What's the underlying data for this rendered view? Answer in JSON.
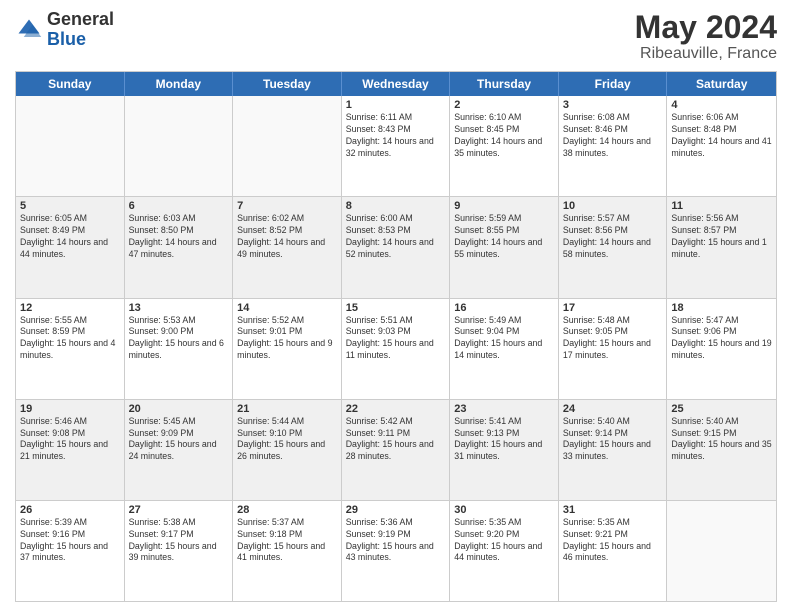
{
  "header": {
    "logo_general": "General",
    "logo_blue": "Blue",
    "month_year": "May 2024",
    "location": "Ribeauville, France"
  },
  "days_of_week": [
    "Sunday",
    "Monday",
    "Tuesday",
    "Wednesday",
    "Thursday",
    "Friday",
    "Saturday"
  ],
  "rows": [
    [
      {
        "day": "",
        "empty": true
      },
      {
        "day": "",
        "empty": true
      },
      {
        "day": "",
        "empty": true
      },
      {
        "day": "1",
        "sunrise": "Sunrise: 6:11 AM",
        "sunset": "Sunset: 8:43 PM",
        "daylight": "Daylight: 14 hours and 32 minutes."
      },
      {
        "day": "2",
        "sunrise": "Sunrise: 6:10 AM",
        "sunset": "Sunset: 8:45 PM",
        "daylight": "Daylight: 14 hours and 35 minutes."
      },
      {
        "day": "3",
        "sunrise": "Sunrise: 6:08 AM",
        "sunset": "Sunset: 8:46 PM",
        "daylight": "Daylight: 14 hours and 38 minutes."
      },
      {
        "day": "4",
        "sunrise": "Sunrise: 6:06 AM",
        "sunset": "Sunset: 8:48 PM",
        "daylight": "Daylight: 14 hours and 41 minutes."
      }
    ],
    [
      {
        "day": "5",
        "sunrise": "Sunrise: 6:05 AM",
        "sunset": "Sunset: 8:49 PM",
        "daylight": "Daylight: 14 hours and 44 minutes."
      },
      {
        "day": "6",
        "sunrise": "Sunrise: 6:03 AM",
        "sunset": "Sunset: 8:50 PM",
        "daylight": "Daylight: 14 hours and 47 minutes."
      },
      {
        "day": "7",
        "sunrise": "Sunrise: 6:02 AM",
        "sunset": "Sunset: 8:52 PM",
        "daylight": "Daylight: 14 hours and 49 minutes."
      },
      {
        "day": "8",
        "sunrise": "Sunrise: 6:00 AM",
        "sunset": "Sunset: 8:53 PM",
        "daylight": "Daylight: 14 hours and 52 minutes."
      },
      {
        "day": "9",
        "sunrise": "Sunrise: 5:59 AM",
        "sunset": "Sunset: 8:55 PM",
        "daylight": "Daylight: 14 hours and 55 minutes."
      },
      {
        "day": "10",
        "sunrise": "Sunrise: 5:57 AM",
        "sunset": "Sunset: 8:56 PM",
        "daylight": "Daylight: 14 hours and 58 minutes."
      },
      {
        "day": "11",
        "sunrise": "Sunrise: 5:56 AM",
        "sunset": "Sunset: 8:57 PM",
        "daylight": "Daylight: 15 hours and 1 minute."
      }
    ],
    [
      {
        "day": "12",
        "sunrise": "Sunrise: 5:55 AM",
        "sunset": "Sunset: 8:59 PM",
        "daylight": "Daylight: 15 hours and 4 minutes."
      },
      {
        "day": "13",
        "sunrise": "Sunrise: 5:53 AM",
        "sunset": "Sunset: 9:00 PM",
        "daylight": "Daylight: 15 hours and 6 minutes."
      },
      {
        "day": "14",
        "sunrise": "Sunrise: 5:52 AM",
        "sunset": "Sunset: 9:01 PM",
        "daylight": "Daylight: 15 hours and 9 minutes."
      },
      {
        "day": "15",
        "sunrise": "Sunrise: 5:51 AM",
        "sunset": "Sunset: 9:03 PM",
        "daylight": "Daylight: 15 hours and 11 minutes."
      },
      {
        "day": "16",
        "sunrise": "Sunrise: 5:49 AM",
        "sunset": "Sunset: 9:04 PM",
        "daylight": "Daylight: 15 hours and 14 minutes."
      },
      {
        "day": "17",
        "sunrise": "Sunrise: 5:48 AM",
        "sunset": "Sunset: 9:05 PM",
        "daylight": "Daylight: 15 hours and 17 minutes."
      },
      {
        "day": "18",
        "sunrise": "Sunrise: 5:47 AM",
        "sunset": "Sunset: 9:06 PM",
        "daylight": "Daylight: 15 hours and 19 minutes."
      }
    ],
    [
      {
        "day": "19",
        "sunrise": "Sunrise: 5:46 AM",
        "sunset": "Sunset: 9:08 PM",
        "daylight": "Daylight: 15 hours and 21 minutes."
      },
      {
        "day": "20",
        "sunrise": "Sunrise: 5:45 AM",
        "sunset": "Sunset: 9:09 PM",
        "daylight": "Daylight: 15 hours and 24 minutes."
      },
      {
        "day": "21",
        "sunrise": "Sunrise: 5:44 AM",
        "sunset": "Sunset: 9:10 PM",
        "daylight": "Daylight: 15 hours and 26 minutes."
      },
      {
        "day": "22",
        "sunrise": "Sunrise: 5:42 AM",
        "sunset": "Sunset: 9:11 PM",
        "daylight": "Daylight: 15 hours and 28 minutes."
      },
      {
        "day": "23",
        "sunrise": "Sunrise: 5:41 AM",
        "sunset": "Sunset: 9:13 PM",
        "daylight": "Daylight: 15 hours and 31 minutes."
      },
      {
        "day": "24",
        "sunrise": "Sunrise: 5:40 AM",
        "sunset": "Sunset: 9:14 PM",
        "daylight": "Daylight: 15 hours and 33 minutes."
      },
      {
        "day": "25",
        "sunrise": "Sunrise: 5:40 AM",
        "sunset": "Sunset: 9:15 PM",
        "daylight": "Daylight: 15 hours and 35 minutes."
      }
    ],
    [
      {
        "day": "26",
        "sunrise": "Sunrise: 5:39 AM",
        "sunset": "Sunset: 9:16 PM",
        "daylight": "Daylight: 15 hours and 37 minutes."
      },
      {
        "day": "27",
        "sunrise": "Sunrise: 5:38 AM",
        "sunset": "Sunset: 9:17 PM",
        "daylight": "Daylight: 15 hours and 39 minutes."
      },
      {
        "day": "28",
        "sunrise": "Sunrise: 5:37 AM",
        "sunset": "Sunset: 9:18 PM",
        "daylight": "Daylight: 15 hours and 41 minutes."
      },
      {
        "day": "29",
        "sunrise": "Sunrise: 5:36 AM",
        "sunset": "Sunset: 9:19 PM",
        "daylight": "Daylight: 15 hours and 43 minutes."
      },
      {
        "day": "30",
        "sunrise": "Sunrise: 5:35 AM",
        "sunset": "Sunset: 9:20 PM",
        "daylight": "Daylight: 15 hours and 44 minutes."
      },
      {
        "day": "31",
        "sunrise": "Sunrise: 5:35 AM",
        "sunset": "Sunset: 9:21 PM",
        "daylight": "Daylight: 15 hours and 46 minutes."
      },
      {
        "day": "",
        "empty": true
      }
    ]
  ]
}
